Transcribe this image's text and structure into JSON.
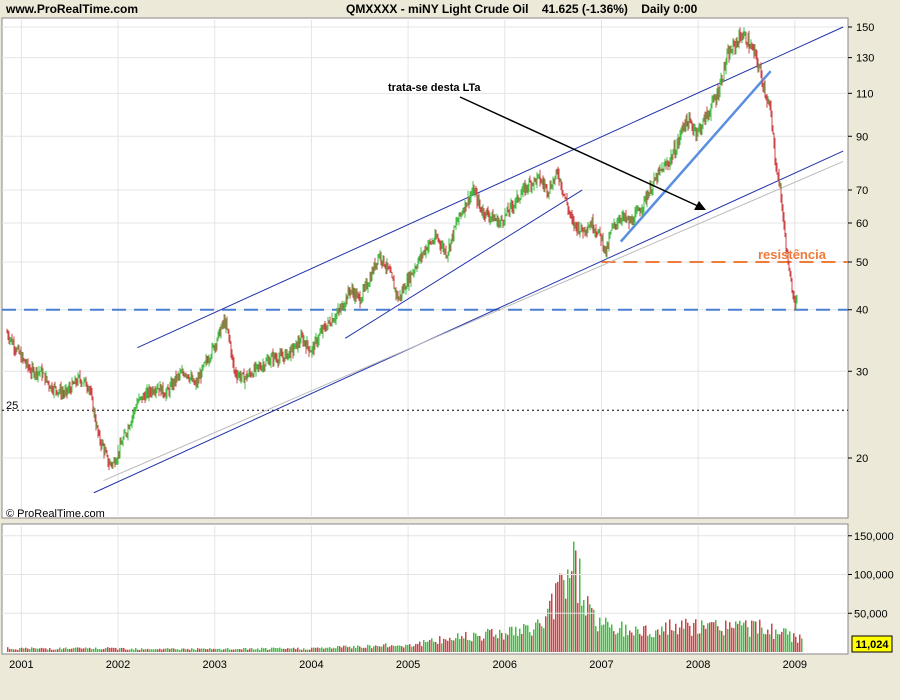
{
  "header": {
    "site": "www.ProRealTime.com",
    "symbol": "QMXXXX",
    "separator": "-",
    "instrument": "miNY Light Crude Oil",
    "last": "41.625",
    "change": "(-1.36%)",
    "period": "Daily",
    "time": "0:00"
  },
  "watermark": "© ProRealTime.com",
  "annotations": {
    "arrow_label": "trata-se desta LTa",
    "resistance_label": "resistência",
    "level_25_label": "25"
  },
  "colors": {
    "background": "#ece9d8",
    "panel": "#ffffff",
    "up_candle": "#44bb44",
    "down_candle": "#cc4444",
    "trendline": "#2233aa",
    "blue_dashed": "#4a7fd4",
    "orange_dashed": "#f07a3a",
    "light_blue_line": "#5a8fe0",
    "volume_up": "#44bb44",
    "volume_down": "#cc4444",
    "volume_badge": "#ffff00"
  },
  "chart_data": [
    {
      "type": "candlestick",
      "scale": "log",
      "ylim": [
        15,
        160
      ],
      "yticks": [
        "20",
        "30",
        "40",
        "50",
        "60",
        "70",
        "90",
        "110",
        "130",
        "150"
      ],
      "xticks": [
        "2001",
        "2002",
        "2003",
        "2004",
        "2005",
        "2006",
        "2007",
        "2008",
        "2009"
      ],
      "x": [
        2000.85,
        2001.0,
        2001.1,
        2001.2,
        2001.3,
        2001.45,
        2001.6,
        2001.7,
        2001.8,
        2001.85,
        2001.9,
        2001.95,
        2002.0,
        2002.1,
        2002.2,
        2002.3,
        2002.4,
        2002.5,
        2002.6,
        2002.7,
        2002.8,
        2002.9,
        2003.0,
        2003.1,
        2003.15,
        2003.2,
        2003.3,
        2003.4,
        2003.5,
        2003.6,
        2003.7,
        2003.8,
        2003.9,
        2004.0,
        2004.1,
        2004.2,
        2004.3,
        2004.4,
        2004.5,
        2004.6,
        2004.7,
        2004.8,
        2004.9,
        2004.95,
        2005.0,
        2005.1,
        2005.2,
        2005.3,
        2005.4,
        2005.5,
        2005.6,
        2005.68,
        2005.75,
        2005.85,
        2005.95,
        2006.05,
        2006.15,
        2006.25,
        2006.35,
        2006.45,
        2006.55,
        2006.6,
        2006.7,
        2006.8,
        2006.9,
        2007.0,
        2007.05,
        2007.1,
        2007.2,
        2007.3,
        2007.4,
        2007.5,
        2007.6,
        2007.7,
        2007.8,
        2007.85,
        2007.9,
        2008.0,
        2008.1,
        2008.2,
        2008.3,
        2008.4,
        2008.45,
        2008.5,
        2008.6,
        2008.7,
        2008.75,
        2008.8,
        2008.85,
        2008.9,
        2008.95,
        2009.0,
        2009.03
      ],
      "close": [
        36,
        32,
        30,
        30,
        28,
        27,
        29,
        28,
        22,
        21,
        19.5,
        19.5,
        20.5,
        23,
        26,
        27,
        28,
        27,
        29,
        30,
        28,
        31,
        34,
        38,
        35,
        30,
        29,
        30,
        31,
        32,
        32,
        33,
        35,
        33,
        36,
        38,
        40,
        44,
        42,
        46,
        52,
        48,
        42,
        44,
        46,
        50,
        54,
        56,
        52,
        60,
        66,
        70,
        64,
        62,
        60,
        64,
        68,
        72,
        74,
        70,
        76,
        70,
        60,
        58,
        60,
        56,
        52,
        58,
        62,
        60,
        64,
        70,
        76,
        80,
        88,
        96,
        96,
        92,
        100,
        110,
        130,
        140,
        145,
        142,
        130,
        110,
        100,
        80,
        70,
        56,
        46,
        42,
        41.6
      ],
      "series": [
        {
          "name": "upper channel",
          "points": [
            [
              2002.2,
              33.5
            ],
            [
              2009.5,
              150
            ]
          ]
        },
        {
          "name": "lower long-term trendline",
          "points": [
            [
              2001.75,
              17
            ],
            [
              2009.5,
              84
            ]
          ]
        },
        {
          "name": "thin grey long-term line",
          "points": [
            [
              2001.85,
              18
            ],
            [
              2009.5,
              80
            ]
          ]
        },
        {
          "name": "2004-2006 support",
          "points": [
            [
              2004.35,
              35
            ],
            [
              2006.8,
              70
            ]
          ]
        },
        {
          "name": "2007-2008 uptrend",
          "points": [
            [
              2007.2,
              55
            ],
            [
              2008.75,
              122
            ]
          ]
        }
      ],
      "levels": [
        {
          "value": 40,
          "style": "dashed",
          "color": "blue"
        },
        {
          "value": 50,
          "style": "dashed",
          "color": "orange"
        },
        {
          "value": 25,
          "style": "dotted",
          "color": "black"
        }
      ]
    },
    {
      "type": "bar",
      "name": "volume",
      "yticks": [
        "50,000",
        "100,000",
        "150,000"
      ],
      "ylim": [
        0,
        160000
      ],
      "current_value": "11,024",
      "x": [
        2001.0,
        2002.0,
        2003.0,
        2004.0,
        2004.5,
        2005.0,
        2005.3,
        2005.6,
        2005.9,
        2006.2,
        2006.4,
        2006.5,
        2006.6,
        2006.7,
        2006.8,
        2006.9,
        2007.0,
        2007.2,
        2007.5,
        2007.8,
        2008.0,
        2008.3,
        2008.5,
        2008.8,
        2009.0
      ],
      "values": [
        5000,
        5000,
        4000,
        5000,
        8000,
        10000,
        16000,
        24000,
        28000,
        30000,
        42000,
        70000,
        110000,
        130000,
        90000,
        52000,
        38000,
        32000,
        30000,
        36000,
        34000,
        38000,
        36000,
        30000,
        20000
      ]
    }
  ]
}
